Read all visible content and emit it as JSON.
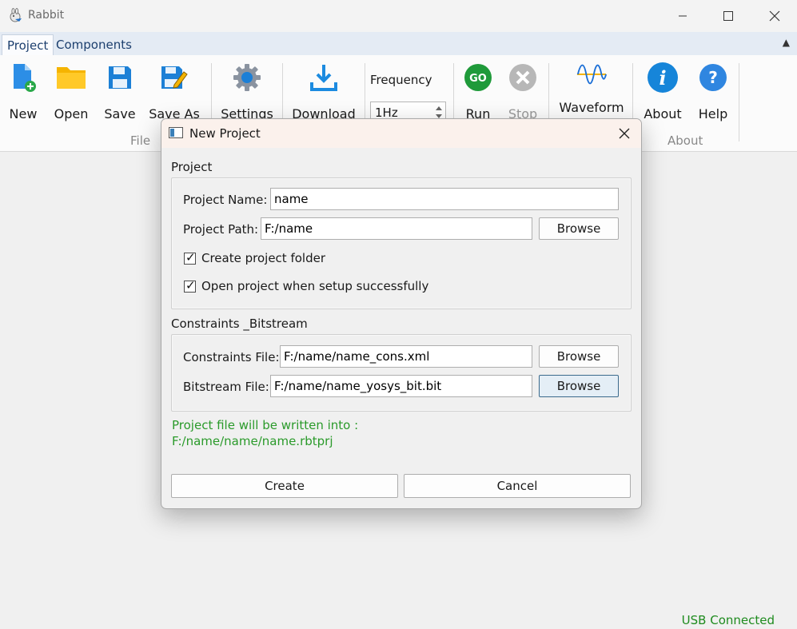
{
  "window": {
    "title": "Rabbit"
  },
  "tabs": [
    {
      "label": "Project",
      "active": true
    },
    {
      "label": "Components",
      "active": false
    }
  ],
  "ribbon": {
    "file_group": {
      "label": "File",
      "new": "New",
      "open": "Open",
      "save": "Save",
      "save_as": "Save As"
    },
    "settings": "Settings",
    "download": "Download",
    "frequency": {
      "label": "Frequency",
      "value": "1Hz"
    },
    "run": "Run",
    "stop": "Stop",
    "waveform": "Waveform",
    "about_group": {
      "label": "About",
      "about": "About",
      "help": "Help"
    }
  },
  "dialog": {
    "title": "New Project",
    "project_section": "Project",
    "project_name_label": "Project Name:",
    "project_name_value": "name",
    "project_path_label": "Project Path:",
    "project_path_value": "F:/name",
    "browse": "Browse",
    "create_folder": {
      "label": "Create project folder",
      "checked": true
    },
    "open_when_done": {
      "label": "Open project when setup successfully",
      "checked": true
    },
    "constraints_section": "Constraints _Bitstream",
    "constraints_file_label": "Constraints File:",
    "constraints_file_value": "F:/name/name_cons.xml",
    "bitstream_file_label": "Bitstream File:",
    "bitstream_file_value": "F:/name/name_yosys_bit.bit",
    "info_line1": "Project file will be written into :",
    "info_line2": "F:/name/name/name.rbtprj",
    "create": "Create",
    "cancel": "Cancel"
  },
  "status": {
    "usb": "USB Connected"
  },
  "colors": {
    "accent": "#1c6fbf",
    "status_green": "#1e8b1e",
    "info_green": "#2a9a2a"
  }
}
